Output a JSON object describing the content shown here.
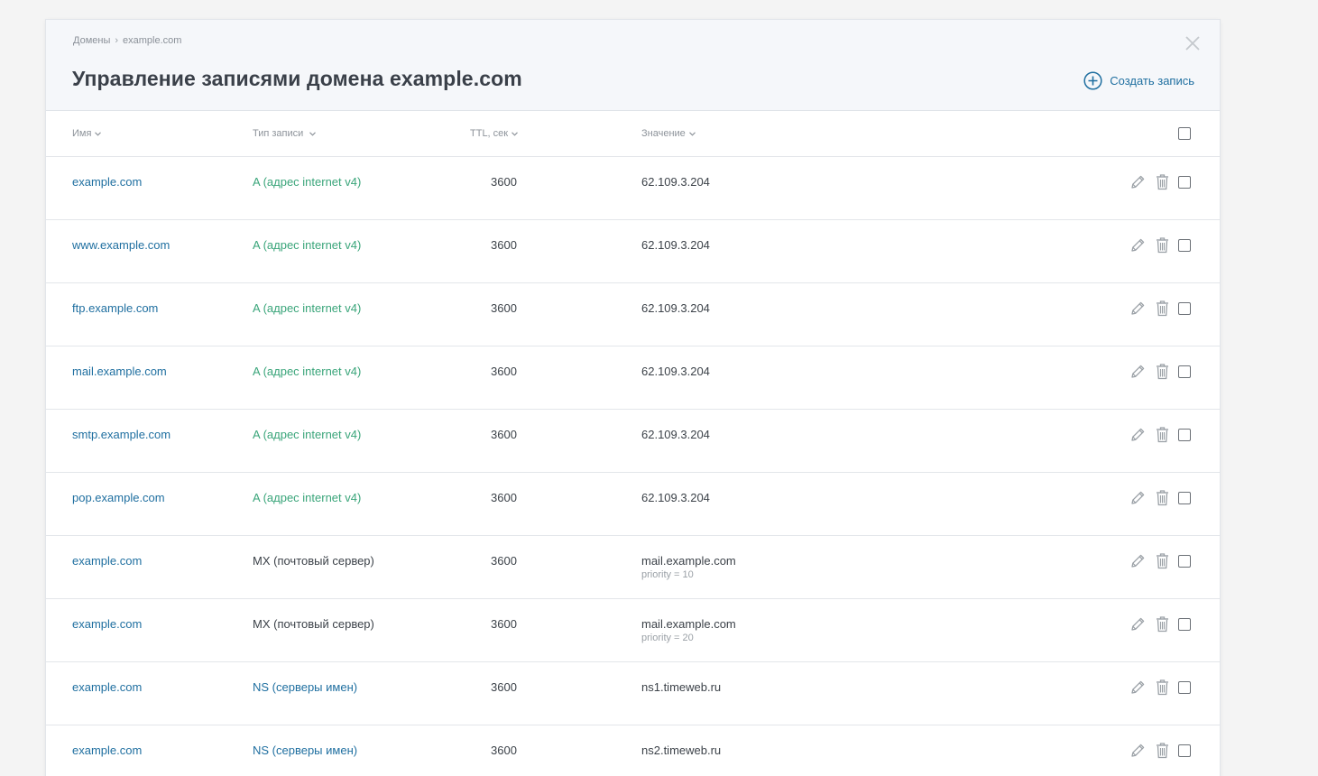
{
  "breadcrumb": {
    "root": "Домены",
    "current": "example.com"
  },
  "title": "Управление записями домена example.com",
  "create_button": {
    "label": "Создать запись",
    "icon": "plus-circle-icon"
  },
  "close_icon": "close-icon",
  "columns": {
    "name": "Имя",
    "type": "Тип записи",
    "ttl": "TTL, сек",
    "value": "Значение"
  },
  "colors": {
    "link": "#1f6fa0",
    "type_a": "#3aa57a",
    "type_mx": "#3c4249",
    "type_ns": "#1f6fa0"
  },
  "records": [
    {
      "name": "example.com",
      "type": "A (адрес internet v4)",
      "type_kind": "a",
      "ttl": "3600",
      "value": "62.109.3.204",
      "sub": ""
    },
    {
      "name": "www.example.com",
      "type": "A (адрес internet v4)",
      "type_kind": "a",
      "ttl": "3600",
      "value": "62.109.3.204",
      "sub": ""
    },
    {
      "name": "ftp.example.com",
      "type": "A (адрес internet v4)",
      "type_kind": "a",
      "ttl": "3600",
      "value": "62.109.3.204",
      "sub": ""
    },
    {
      "name": "mail.example.com",
      "type": "A (адрес internet v4)",
      "type_kind": "a",
      "ttl": "3600",
      "value": "62.109.3.204",
      "sub": ""
    },
    {
      "name": "smtp.example.com",
      "type": "A (адрес internet v4)",
      "type_kind": "a",
      "ttl": "3600",
      "value": "62.109.3.204",
      "sub": ""
    },
    {
      "name": "pop.example.com",
      "type": "A (адрес internet v4)",
      "type_kind": "a",
      "ttl": "3600",
      "value": "62.109.3.204",
      "sub": ""
    },
    {
      "name": "example.com",
      "type": "MX (почтовый сервер)",
      "type_kind": "mx",
      "ttl": "3600",
      "value": "mail.example.com",
      "sub": "priority = 10"
    },
    {
      "name": "example.com",
      "type": "MX (почтовый сервер)",
      "type_kind": "mx",
      "ttl": "3600",
      "value": "mail.example.com",
      "sub": "priority = 20"
    },
    {
      "name": "example.com",
      "type": "NS (серверы имен)",
      "type_kind": "ns",
      "ttl": "3600",
      "value": "ns1.timeweb.ru",
      "sub": ""
    },
    {
      "name": "example.com",
      "type": "NS (серверы имен)",
      "type_kind": "ns",
      "ttl": "3600",
      "value": "ns2.timeweb.ru",
      "sub": ""
    }
  ]
}
